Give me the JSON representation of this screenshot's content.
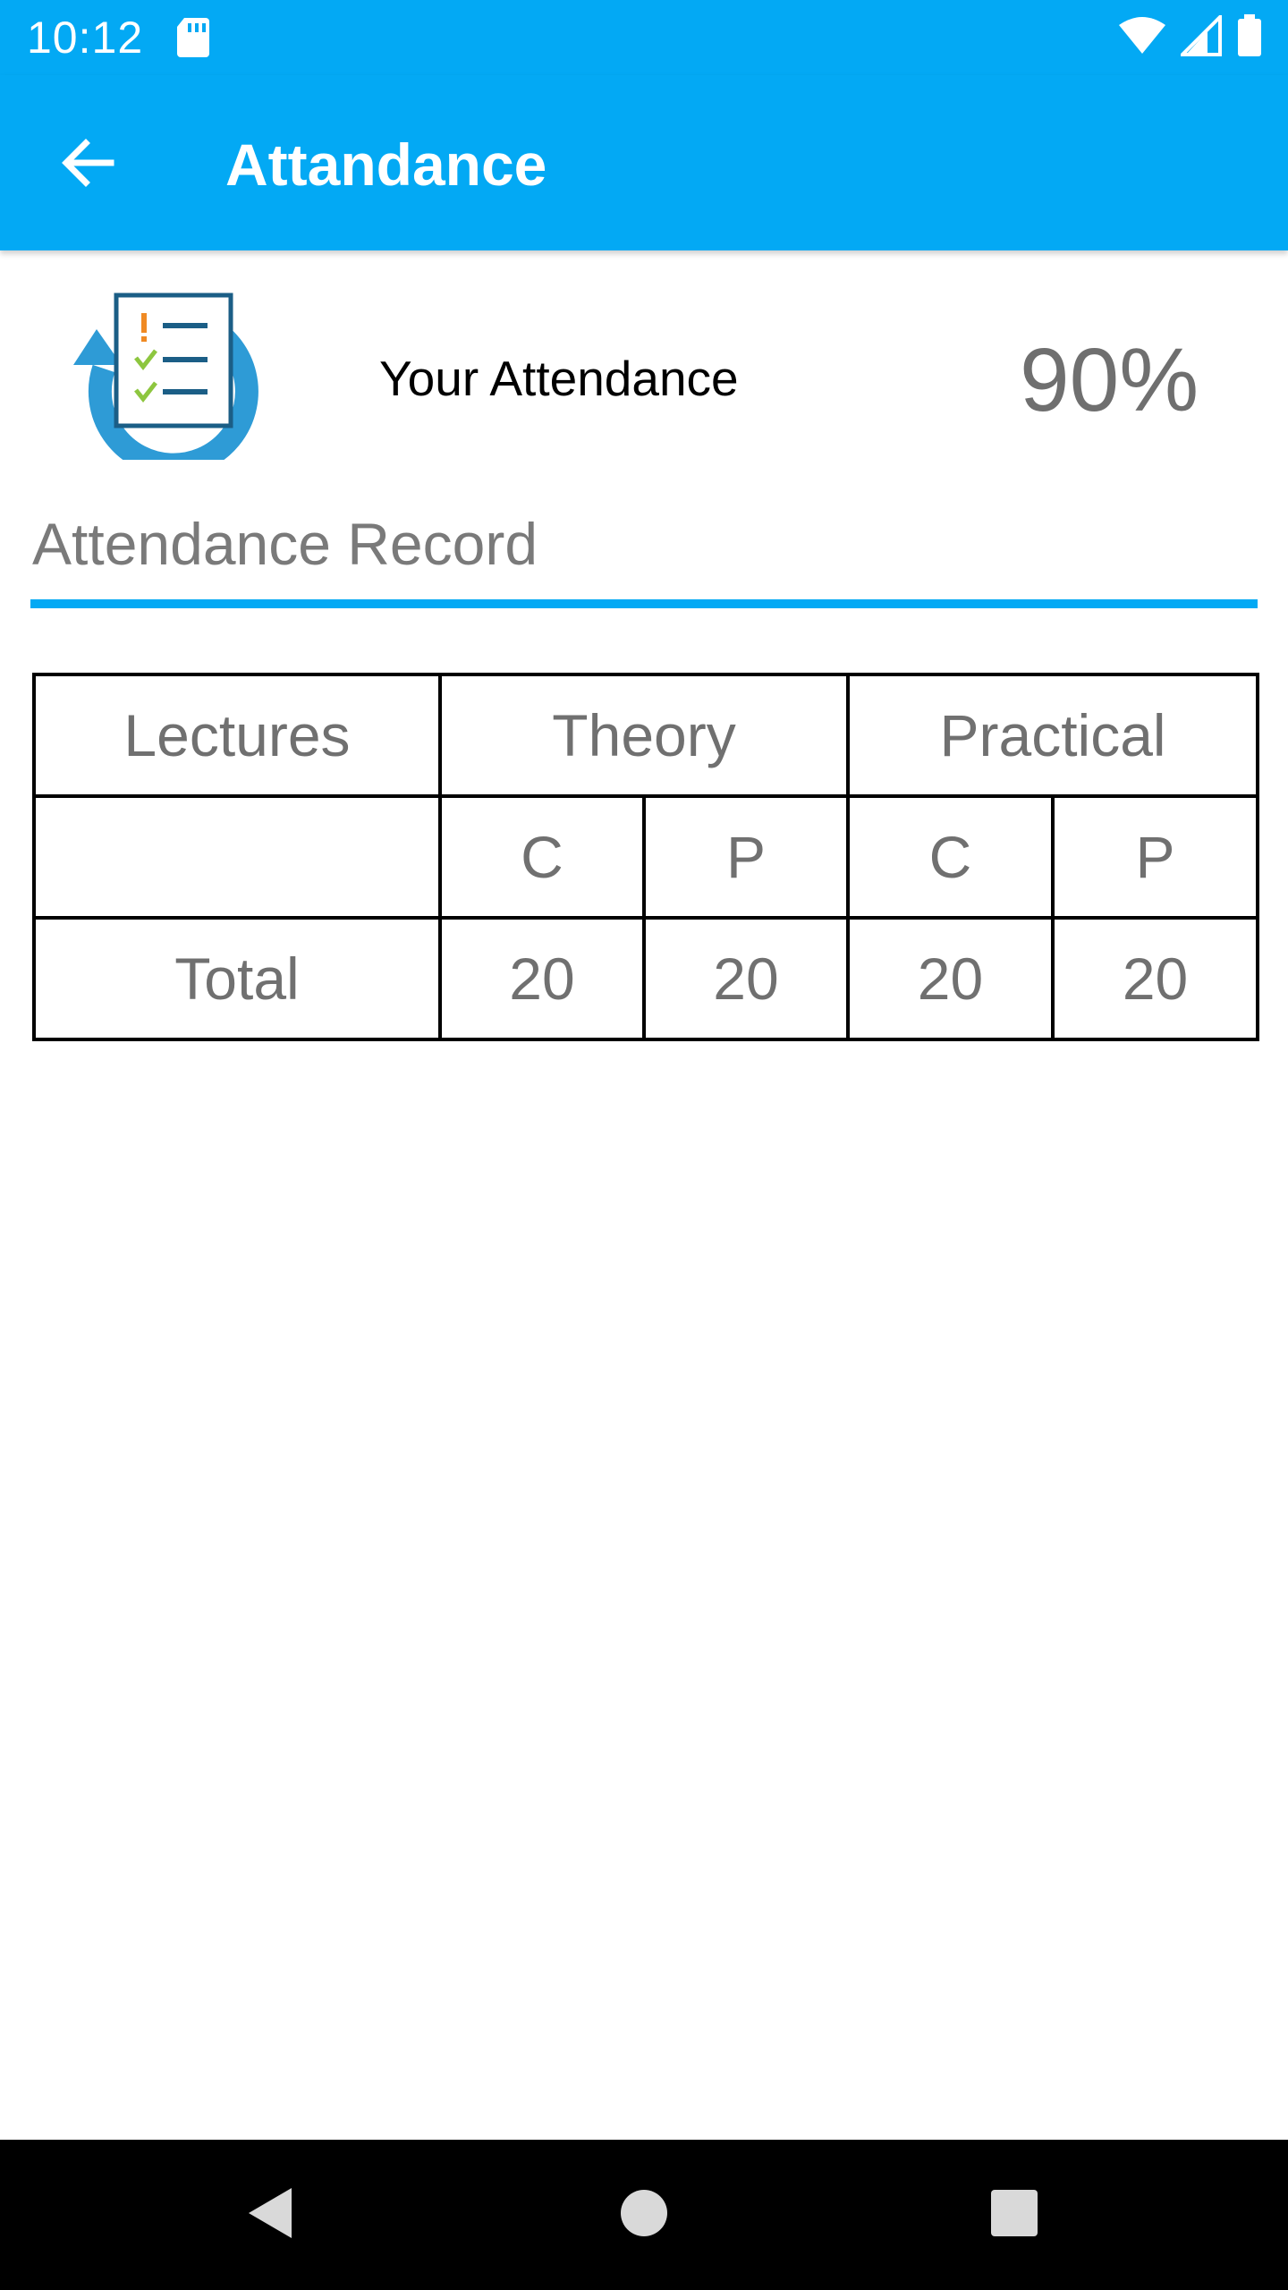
{
  "status_bar": {
    "time": "10:12",
    "icons": [
      "sd-card-icon",
      "wifi-icon",
      "signal-icon",
      "battery-icon"
    ]
  },
  "app_bar": {
    "title": "Attandance",
    "back_icon": "arrow-back-icon",
    "color": "#03A9F4"
  },
  "summary": {
    "icon": "attendance-checklist-icon",
    "label": "Your Attendance",
    "value": "90%"
  },
  "section": {
    "title": "Attendance Record",
    "accent": "#03A9F4"
  },
  "table": {
    "headers": {
      "lectures": "Lectures",
      "theory": "Theory",
      "practical": "Practical"
    },
    "subheaders": {
      "theory_c": "C",
      "theory_p": "P",
      "practical_c": "C",
      "practical_p": "P"
    },
    "total_row": {
      "label": "Total",
      "theory_c": "20",
      "theory_p": "20",
      "practical_c": "20",
      "practical_p": "20"
    }
  },
  "nav_bar": {
    "icons": [
      "nav-back-icon",
      "nav-home-icon",
      "nav-recents-icon"
    ]
  }
}
